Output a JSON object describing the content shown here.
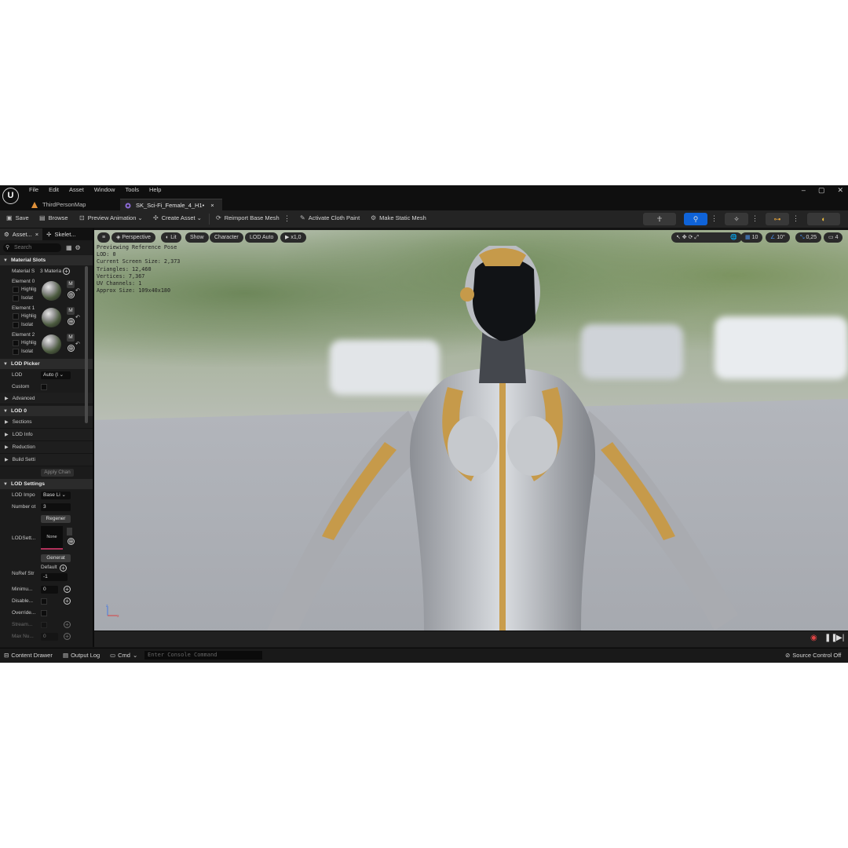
{
  "menubar": {
    "items": [
      "File",
      "Edit",
      "Asset",
      "Window",
      "Tools",
      "Help"
    ],
    "window_controls": [
      "–",
      "▢",
      "✕"
    ]
  },
  "tabs": [
    {
      "label": "ThirdPersonMap"
    },
    {
      "label": "SK_Sci-Fi_Female_4_H1•",
      "close": "×"
    }
  ],
  "toolbar": {
    "save": "Save",
    "browse": "Browse",
    "preview_animation": "Preview Animation",
    "create_asset": "Create Asset",
    "reimport": "Reimport Base Mesh",
    "activate_cloth": "Activate Cloth Paint",
    "make_static": "Make Static Mesh"
  },
  "left_panel": {
    "tab_asset": "Asset...",
    "tab_skeleton": "Skelet...",
    "search_placeholder": "Search",
    "sections": {
      "material_slots": "Material Slots",
      "lod_picker": "LOD Picker",
      "advanced": "Advanced",
      "lod0": "LOD 0",
      "lod_settings": "LOD Settings"
    },
    "material_s_label": "Material S",
    "material_s_value": "3 Materia",
    "elements": [
      {
        "label": "Element 0",
        "highlight": "Highlig",
        "isolate": "Isolat",
        "m": "M"
      },
      {
        "label": "Element 1",
        "highlight": "Highlig",
        "isolate": "Isolat",
        "m": "M"
      },
      {
        "label": "Element 2",
        "highlight": "Highlig",
        "isolate": "Isolat",
        "m": "M"
      }
    ],
    "lod_label": "LOD",
    "lod_value": "Auto (l",
    "custom_label": "Custom",
    "lod0_items": [
      "Sections",
      "LOD Info",
      "Reduction",
      "Build Setti"
    ],
    "apply_changes": "Apply Chan",
    "lod_import_label": "LOD Impo",
    "lod_import_value": "Base Li",
    "number_label": "Number ot",
    "number_value": "3",
    "regenerate": "Regener",
    "lodsett_label": "LODSett...",
    "none_label": "None",
    "generate": "Generat",
    "noref_label": "NoRef Str",
    "default_label": "Default",
    "noref_value": "-1",
    "minimum_label": "Minimu...",
    "minimum_value": "0",
    "disable_label": "Disable...",
    "override_label": "Override...",
    "stream_label": "Stream...",
    "maxnu_label": "Max Nu...",
    "maxnu_value": "0"
  },
  "viewport": {
    "perspective": "Perspective",
    "lit": "Lit",
    "show": "Show",
    "character": "Character",
    "lod_auto": "LOD Auto",
    "speed": "x1,0",
    "grid": "10",
    "angle": "10°",
    "scale": "0,25",
    "camera": "4",
    "stats": [
      "Previewing Reference Pose",
      "LOD: 0",
      "Current Screen Size: 2,373",
      "Triangles: 12,460",
      "Vertices: 7,367",
      "UV Channels: 1",
      "Approx Size: 109x40x180"
    ]
  },
  "statusbar": {
    "content_drawer": "Content Drawer",
    "output_log": "Output Log",
    "cmd": "Cmd",
    "console_placeholder": "Enter Console Command",
    "source_control": "Source Control Off"
  }
}
